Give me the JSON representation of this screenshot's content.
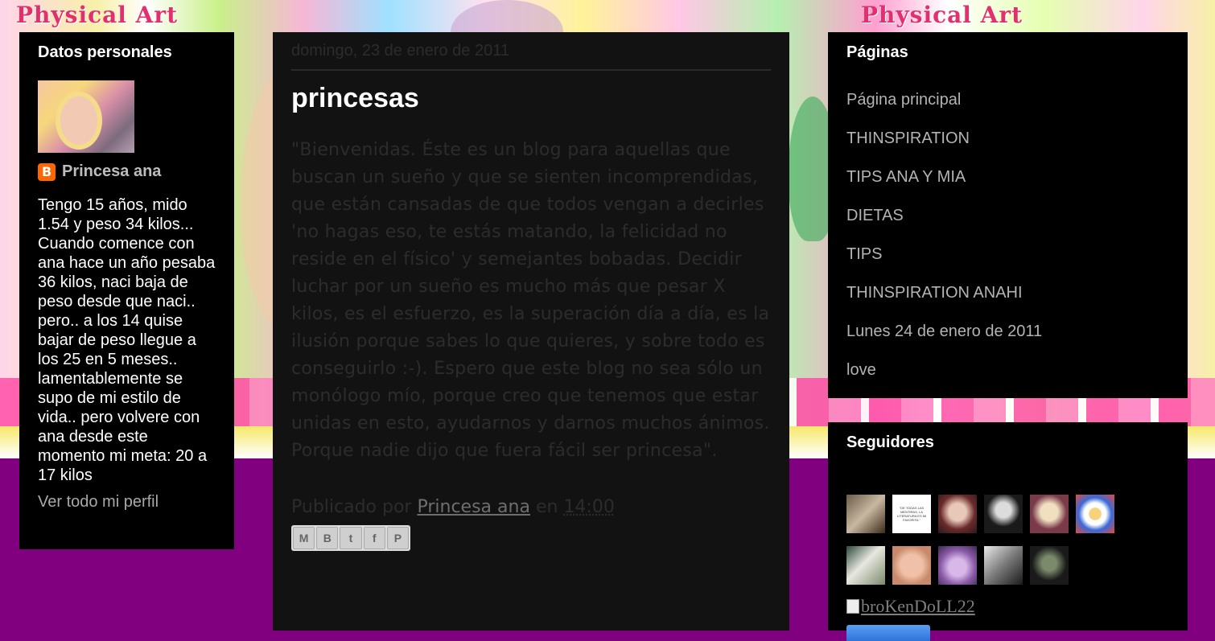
{
  "header": {
    "logo_text": "Physical Art"
  },
  "profile": {
    "title": "Datos personales",
    "name": "Princesa ana",
    "description": "Tengo 15 años, mido 1.54 y peso 34 kilos... Cuando comence con ana hace un año pesaba 36 kilos, naci baja de peso desde que naci.. pero.. a los 14 quise bajar de peso llegue a los 25 en 5 meses.. lamentablemente se supo de mi estilo de vida.. pero volvere con ana desde este momento mi meta: 20 a 17 kilos",
    "view_profile": "Ver todo mi perfil"
  },
  "post": {
    "date": "domingo, 23 de enero de 2011",
    "title": "princesas",
    "body": "\"Bienvenidas. Éste es un blog para aquellas que buscan un sueño y que se sienten incomprendidas, que están cansadas de que todos vengan a decirles 'no hagas eso, te estás matando, la felicidad no reside en el físico' y semejantes bobadas. Decidir luchar por un sueño es mucho más que pesar X kilos, es el esfuerzo, es la superación día a día, es la ilusión porque sabes lo que quieres, y sobre todo es conseguirlo :-). Espero que este blog no sea sólo un monólogo mío, porque creo que tenemos que estar unidas en esto, ayudarnos y darnos muchos ánimos. Porque nadie dijo que fuera fácil ser princesa\".",
    "published_by": "Publicado por",
    "author": "Princesa ana",
    "at": "en",
    "time": "14:00"
  },
  "pages": {
    "title": "Páginas",
    "items": [
      "Página principal",
      "THINSPIRATION",
      "TIPS ANA Y MIA",
      "DIETAS",
      "TIPS",
      "THINSPIRATION ANAHI",
      "Lunes 24 de enero de 2011",
      "love"
    ]
  },
  "followers": {
    "title": "Seguidores",
    "broken_image_alt": "broKenDoLL22",
    "avatar_colors": [
      "#5a4a3a",
      "#ffffff",
      "#c98a7a",
      "#2a2a2a",
      "#7a3a4a",
      "#e8f0ff",
      "#4a6a5a",
      "#d8b8a0",
      "#9a7ab0",
      "#8a8a8a",
      "#3a4a2a"
    ],
    "avatar_text_2": "\"DE TODAS LAS MENTIRAS, LA LITERATURA ES MI FAVORITA.\""
  },
  "colors": {
    "page_bg": "#800080",
    "column_bg": "#000000",
    "main_bg": "#121212",
    "link_gray": "#b3b3b3"
  }
}
